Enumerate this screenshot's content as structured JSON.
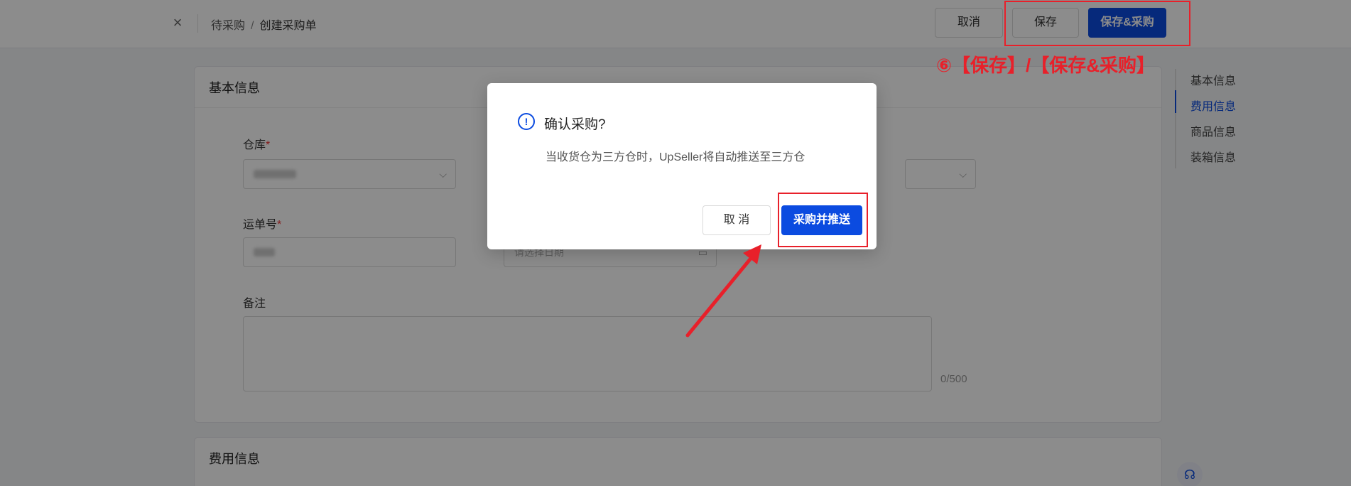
{
  "header": {
    "close_glyph": "×",
    "breadcrumb": [
      "待采购",
      "创建采购单"
    ],
    "separator": "/",
    "cancel_label": "取消",
    "save_label": "保存",
    "save_buy_label": "保存&采购"
  },
  "basic_info": {
    "title": "基本信息",
    "warehouse_label": "仓库",
    "required_mark": "*",
    "tracking_label": "运单号",
    "date_placeholder": "请选择日期",
    "remark_label": "备注",
    "remark_counter": "0/500"
  },
  "fee_section": {
    "title": "费用信息"
  },
  "right_nav": {
    "items": [
      "基本信息",
      "费用信息",
      "商品信息",
      "装箱信息"
    ],
    "active": "费用信息"
  },
  "modal": {
    "title": "确认采购?",
    "message": "当收货仓为三方仓时，UpSeller将自动推送至三方仓",
    "cancel_label": "取 消",
    "confirm_label": "采购并推送"
  },
  "annotation": {
    "text": "⑥【保存】/【保存&采购】",
    "color": "#e8202a"
  },
  "colors": {
    "primary": "#0b4be0",
    "annotation": "#e8202a"
  }
}
